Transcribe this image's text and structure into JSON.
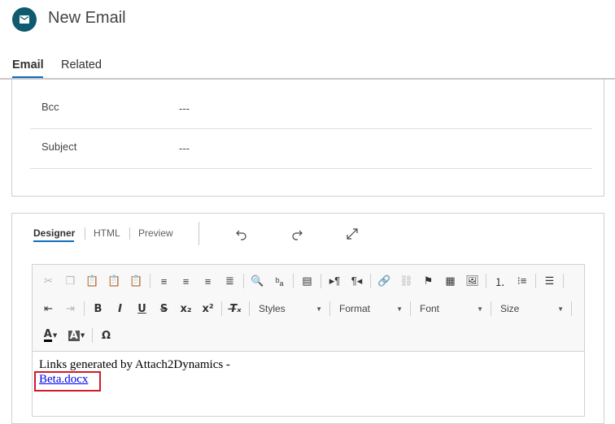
{
  "header": {
    "title": "New Email",
    "tabs": [
      {
        "label": "Email"
      },
      {
        "label": "Related"
      }
    ]
  },
  "fields": [
    {
      "label": "Bcc",
      "value": "---"
    },
    {
      "label": "Subject",
      "value": "---"
    }
  ],
  "editor": {
    "tabs": [
      {
        "label": "Designer"
      },
      {
        "label": "HTML"
      },
      {
        "label": "Preview"
      }
    ],
    "combos": {
      "styles": "Styles",
      "format": "Format",
      "font": "Font",
      "size": "Size"
    },
    "content": {
      "line1": "Links generated by Attach2Dynamics -",
      "link": "Beta.docx"
    }
  },
  "colors": {
    "accent": "#0f6cbd",
    "avatar": "#0f5a6e",
    "highlight": "#d11a2a"
  }
}
